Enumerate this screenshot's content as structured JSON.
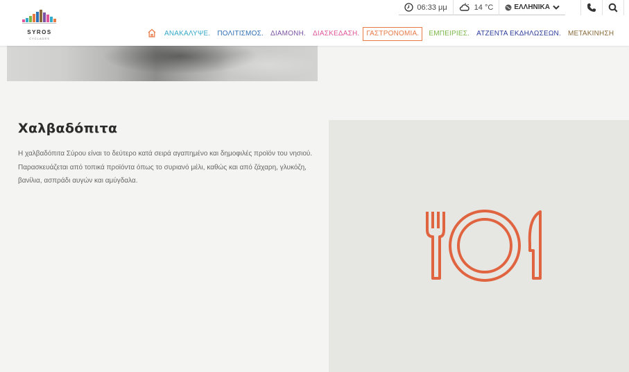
{
  "brand": {
    "name": "SYROS",
    "tagline": "CYCLADES"
  },
  "topbar": {
    "time": "06:33 μμ",
    "temperature": "14 °C",
    "language": "ΕΛΛΗΝΙΚΑ"
  },
  "nav": {
    "items": [
      {
        "label": "ΑΝΑΚΑΛΥΨΕ.",
        "color": "#35a9c9"
      },
      {
        "label": "ΠΟΛΙΤΙΣΜΟΣ.",
        "color": "#2f6fb3"
      },
      {
        "label": "ΔΙΑΜΟΝΗ.",
        "color": "#7c54a6"
      },
      {
        "label": "ΔΙΑΣΚΕΔΑΣΗ.",
        "color": "#e0569a"
      },
      {
        "label": "ΓΑΣΤΡΟΝΟΜΙΑ.",
        "color": "#e87a46"
      },
      {
        "label": "ΕΜΠΕΙΡΙΕΣ.",
        "color": "#7ab648"
      },
      {
        "label": "ΑΤΖΕΝΤΑ ΕΚΔΗΛΩΣΕΩΝ.",
        "color": "#2b3c9a"
      },
      {
        "label": "ΜΕΤΑΚΙΝΗΣΗ",
        "color": "#8a6a3a"
      }
    ]
  },
  "article": {
    "title": "Χαλβαδόπιτα",
    "description": "Η χαλβαδόπιτα Σύρου είναι το δεύτερο κατά σειρά αγαπημένο και δημοφιλές προϊόν του νησιού. Παρασκευάζεται από τοπικά προϊόντα όπως το συριανό μέλι, καθώς και από ζάχαρη, γλυκόζη, βανίλια, ασπράδι αυγών και αμύγδαλα."
  },
  "icons": {
    "home": "home-icon",
    "clock": "clock-icon",
    "weather": "cloud-sun-icon",
    "globe": "globe-icon",
    "chevron": "chevron-down-icon",
    "phone": "phone-icon",
    "search": "search-icon",
    "food": "fork-plate-knife-icon"
  },
  "colors": {
    "accent": "#e87a46",
    "food_icon": "#e0643f"
  }
}
